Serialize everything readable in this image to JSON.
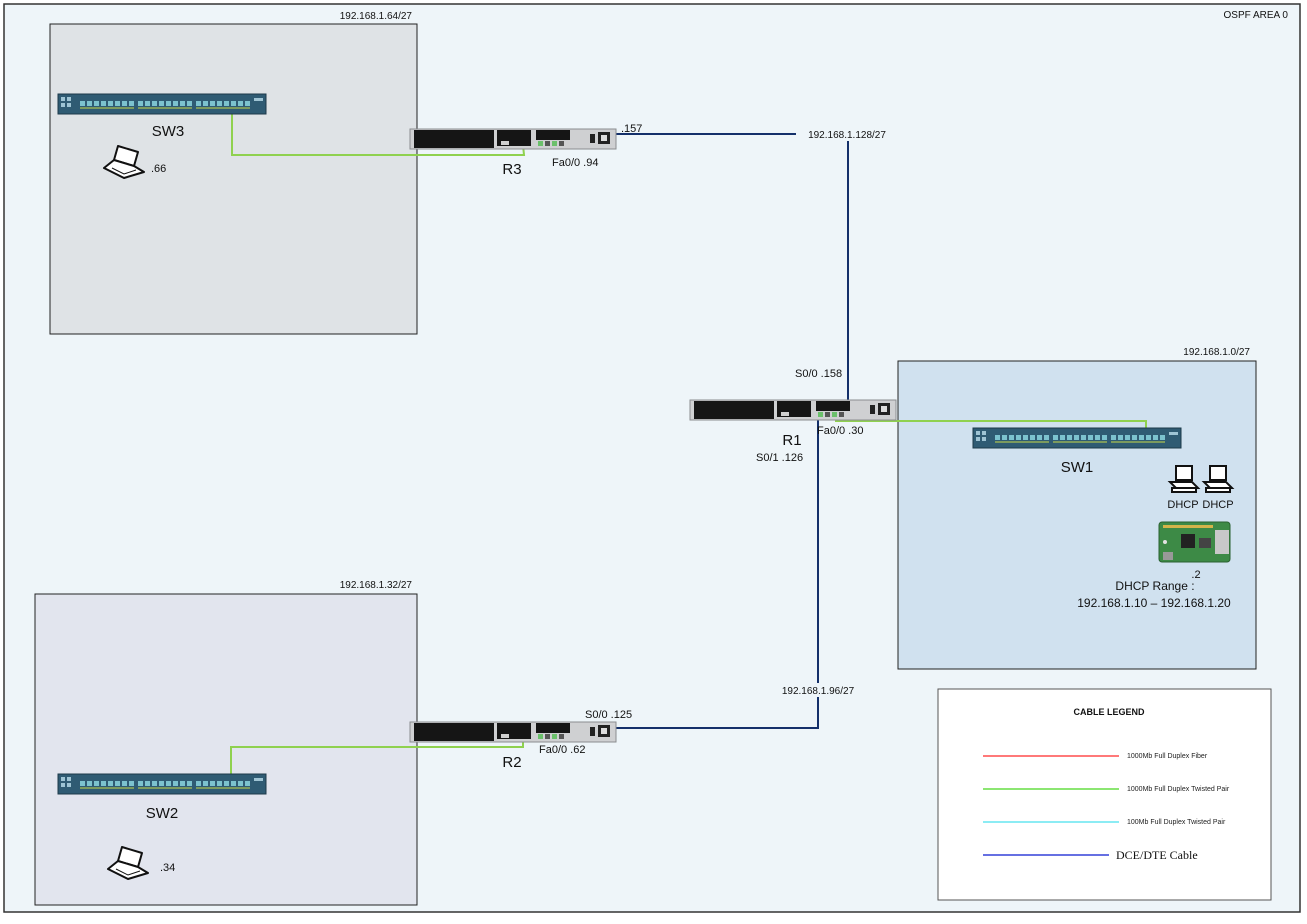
{
  "area_label": "OSPF AREA 0",
  "colors": {
    "background": "#eef5f9",
    "frame": "#333333",
    "zone_sw3": "#dfe3e6",
    "zone_sw2": "#e2e5ee",
    "zone_sw1": "#d0e1ef",
    "serial_cable": "#14306a",
    "ethernet_cable": "#8fd14f",
    "switch_body": "#2f5b73",
    "port": "#7cc2ce",
    "router_dark": "#151515",
    "router_light": "#cfd0d2",
    "pcb": "#3d8a46"
  },
  "zones": {
    "sw3": {
      "subnet": "192.168.1.64/27"
    },
    "sw2": {
      "subnet": "192.168.1.32/27"
    },
    "sw1": {
      "subnet": "192.168.1.0/27"
    }
  },
  "devices": {
    "r1": {
      "label": "R1",
      "iface_top": "S0/0 .158",
      "iface_fa": "Fa0/0 .30",
      "iface_bottom": "S0/1 .126",
      "icon": "router-icon"
    },
    "r2": {
      "label": "R2",
      "iface_serial": "S0/0 .125",
      "iface_fa": "Fa0/0 .62",
      "icon": "router-icon"
    },
    "r3": {
      "label": "R3",
      "iface_serial": ".157",
      "iface_fa": "Fa0/0 .94",
      "icon": "router-icon"
    },
    "sw1": {
      "label": "SW1",
      "icon": "switch-icon"
    },
    "sw2": {
      "label": "SW2",
      "icon": "switch-icon"
    },
    "sw3": {
      "label": "SW3",
      "icon": "switch-icon"
    },
    "laptop_sw3": {
      "ip": ".66",
      "icon": "laptop-icon"
    },
    "laptop_sw2": {
      "ip": ".34",
      "icon": "laptop-icon"
    },
    "pc1": {
      "label": "DHCP",
      "icon": "desktop-icon"
    },
    "pc2": {
      "label": "DHCP",
      "icon": "desktop-icon"
    },
    "server": {
      "ip": ".2",
      "icon": "raspberry-pi-icon"
    }
  },
  "links": {
    "r1_r3_subnet": "192.168.1.128/27",
    "r1_r2_subnet": "192.168.1.96/27"
  },
  "dhcp": {
    "range_label": "DHCP Range :",
    "range_value": "192.168.1.10 – 192.168.1.20"
  },
  "legend": {
    "title": "CABLE LEGEND",
    "items": [
      {
        "label": "1000Mb Full Duplex Fiber",
        "color": "#ff4d4d"
      },
      {
        "label": "1000Mb Full Duplex Twisted Pair",
        "color": "#66dd44"
      },
      {
        "label": "100Mb Full Duplex Twisted Pair",
        "color": "#66e6f0"
      },
      {
        "label": "DCE/DTE Cable",
        "color": "#3340d8"
      }
    ]
  }
}
